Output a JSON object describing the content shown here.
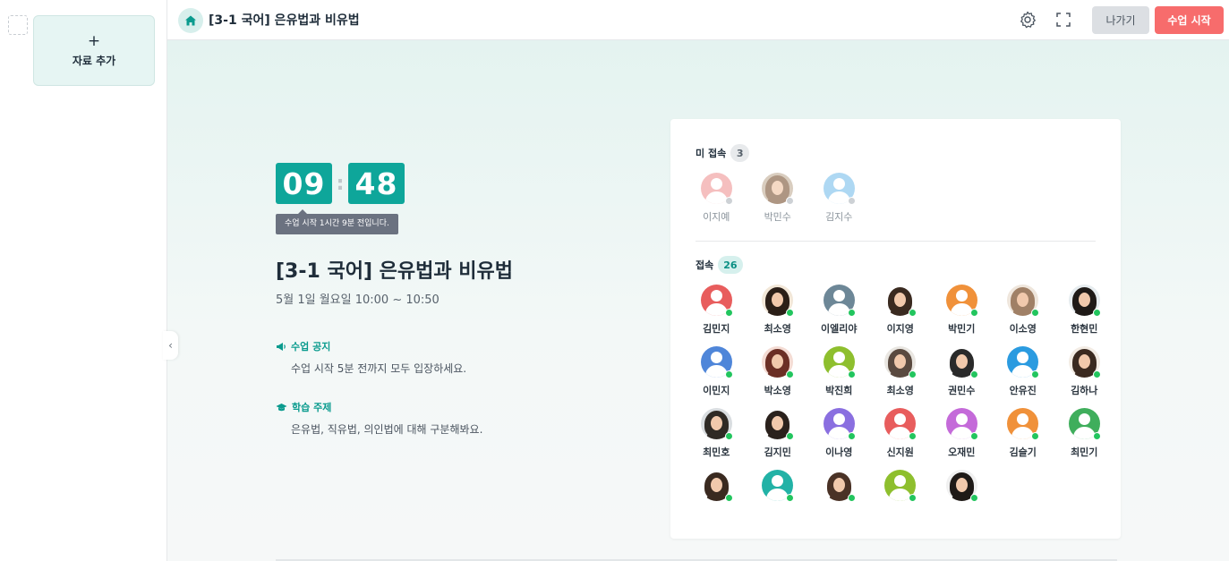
{
  "sidebar": {
    "add_material_plus": "+",
    "add_material_label": "자료 추가"
  },
  "topbar": {
    "title": "[3-1 국어] 은유법과 비유법",
    "leave_label": "나가기",
    "start_label": "수업 시작",
    "icons": [
      "home-icon",
      "settings-icon",
      "fullscreen-icon"
    ]
  },
  "colors": {
    "accent": "#0ea69a",
    "start": "#f76c6c",
    "online": "#22c55e"
  },
  "timer": {
    "hours": "09",
    "minutes": "48",
    "tooltip": "수업 시작 1시간 9분 전입니다."
  },
  "lesson": {
    "title": "[3-1 국어] 은유법과 비유법",
    "time": "5월 1일 월요일 10:00 ~ 10:50",
    "notice_label": "수업 공지",
    "notice_text": "수업 시작 5분 전까지 모두 입장하세요.",
    "topic_label": "학습 주제",
    "topic_text": "은유법, 직유법, 의인법에 대해 구분해봐요."
  },
  "attendance": {
    "offline_label": "미 접속",
    "offline_count": "3",
    "online_label": "접속",
    "online_count": "26",
    "offline": [
      {
        "name": "이지예",
        "kind": "default",
        "color": "#f2a4a4"
      },
      {
        "name": "박민수",
        "kind": "photo",
        "color": "#c9b8a5",
        "hair": "#8c6b4f"
      },
      {
        "name": "김지수",
        "kind": "default",
        "color": "#8cc8ee"
      }
    ],
    "online": [
      {
        "name": "김민지",
        "kind": "default",
        "color": "#e85d5d"
      },
      {
        "name": "최소영",
        "kind": "photo",
        "color": "#f2e7d8",
        "hair": "#2b1f18"
      },
      {
        "name": "이엘리야",
        "kind": "default",
        "color": "#6d8797"
      },
      {
        "name": "이지영",
        "kind": "photo",
        "color": "#ffffff",
        "hair": "#3a2a20"
      },
      {
        "name": "박민기",
        "kind": "default",
        "color": "#f0913a"
      },
      {
        "name": "이소영",
        "kind": "photo",
        "color": "#efe6dc",
        "hair": "#a08066"
      },
      {
        "name": "한현민",
        "kind": "photo",
        "color": "#e6ecef",
        "hair": "#1f1a17"
      },
      {
        "name": "이민지",
        "kind": "default",
        "color": "#4f86d9"
      },
      {
        "name": "박소영",
        "kind": "photo",
        "color": "#f4dcd4",
        "hair": "#6b2f25"
      },
      {
        "name": "박진희",
        "kind": "default",
        "color": "#8ebf2e"
      },
      {
        "name": "최소영",
        "kind": "photo",
        "color": "#e9e6e1",
        "hair": "#5a4a40"
      },
      {
        "name": "권민수",
        "kind": "photo",
        "color": "#ffffff",
        "hair": "#2a2a2a"
      },
      {
        "name": "안유진",
        "kind": "default",
        "color": "#2b9be0"
      },
      {
        "name": "김하나",
        "kind": "photo",
        "color": "#f3ece4",
        "hair": "#3b2a20"
      },
      {
        "name": "최민호",
        "kind": "photo",
        "color": "#d9dde0",
        "hair": "#2f2a25"
      },
      {
        "name": "김지민",
        "kind": "photo",
        "color": "#ffffff",
        "hair": "#2a211c"
      },
      {
        "name": "이나영",
        "kind": "default",
        "color": "#8a6fe0"
      },
      {
        "name": "신지원",
        "kind": "default",
        "color": "#e85d5d"
      },
      {
        "name": "오재민",
        "kind": "default",
        "color": "#c46ad9"
      },
      {
        "name": "김슬기",
        "kind": "default",
        "color": "#f0913a"
      },
      {
        "name": "최민기",
        "kind": "default",
        "color": "#3fae5c"
      },
      {
        "name": "",
        "kind": "photo",
        "color": "#ffffff",
        "hair": "#3a2a20"
      },
      {
        "name": "",
        "kind": "default",
        "color": "#22b2a6"
      },
      {
        "name": "",
        "kind": "photo",
        "color": "#ffffff",
        "hair": "#4a3226"
      },
      {
        "name": "",
        "kind": "default",
        "color": "#8ebf2e"
      },
      {
        "name": "",
        "kind": "photo",
        "color": "#f0f0f0",
        "hair": "#1f1a17"
      }
    ]
  }
}
